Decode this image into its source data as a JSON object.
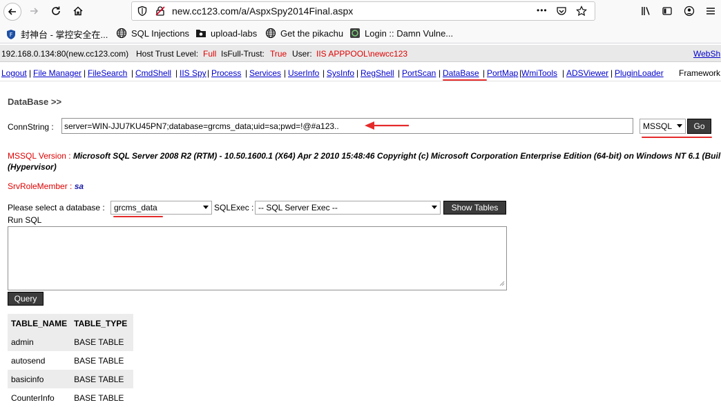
{
  "browser": {
    "url": "new.cc123.com/a/AspxSpy2014Final.aspx",
    "icons": [
      "back-icon",
      "forward-icon",
      "reload-icon",
      "home-icon",
      "shield-icon",
      "insecure-lock-icon",
      "more-icon",
      "pocket-icon",
      "bookmark-star-icon",
      "library-icon",
      "sidebar-icon",
      "account-icon",
      "menu-icon"
    ],
    "more_label": "•••"
  },
  "bookmarks": [
    {
      "label": "封神台 - 掌控安全在...",
      "icon": "shield-f-icon"
    },
    {
      "label": "SQL Injections",
      "icon": "globe-icon"
    },
    {
      "label": "upload-labs",
      "icon": "folder-icon"
    },
    {
      "label": "Get the pikachu",
      "icon": "globe-icon"
    },
    {
      "label": "Login :: Damn Vulne...",
      "icon": "dvwa-icon"
    }
  ],
  "host": {
    "address": "192.168.0.134:80(new.cc123.com)",
    "trust_label": "Host Trust Level:",
    "trust_value": "Full",
    "isfull_label": "IsFull-Trust:",
    "isfull_value": "True",
    "user_label": "User:",
    "user_value": "IIS APPPOOL\\newcc123",
    "right_link": "WebSh"
  },
  "nav": [
    "Logout",
    "File Manager",
    "FileSearch",
    "CmdShell",
    "IIS Spy",
    "Process",
    "Services",
    "UserInfo",
    "SysInfo",
    "RegShell",
    "PortScan",
    "DataBase",
    "PortMap",
    "WmiTools",
    "ADSViewer",
    "PluginLoader",
    "Framework"
  ],
  "nav_sep": "|",
  "database": {
    "heading": "DataBase >>",
    "conn_label": "ConnString :",
    "conn_value": "server=WIN-JJU7KU45PN7;database=grcms_data;uid=sa;pwd=!@#a123..",
    "db_type": "MSSQL",
    "go_label": "Go",
    "version_label": "MSSQL Version :",
    "version_value": "Microsoft SQL Server 2008 R2 (RTM) - 10.50.1600.1 (X64) Apr 2 2010 15:48:46 Copyright (c) Microsoft Corporation Enterprise Edition (64-bit) on Windows NT 6.1 (Buil",
    "version_value_2": "(Hypervisor)",
    "role_label": "SrvRoleMember :",
    "role_value": "sa",
    "select_label": "Please select a database :",
    "selected_db": "grcms_data",
    "sqlexec_label": "SQLExec :",
    "sqlexec_value": "-- SQL Server Exec --",
    "show_tables_label": "Show Tables",
    "run_sql_label": "Run SQL",
    "query_label": "Query"
  },
  "table": {
    "headers": [
      "TABLE_NAME",
      "TABLE_TYPE"
    ],
    "rows": [
      [
        "admin",
        "BASE TABLE"
      ],
      [
        "autosend",
        "BASE TABLE"
      ],
      [
        "basicinfo",
        "BASE TABLE"
      ],
      [
        "CounterInfo",
        "BASE TABLE"
      ]
    ]
  },
  "colors": {
    "red_text": "#e00000",
    "link": "#0000cc",
    "annotation": "#e52a2a",
    "button": "#3b3b3b"
  }
}
